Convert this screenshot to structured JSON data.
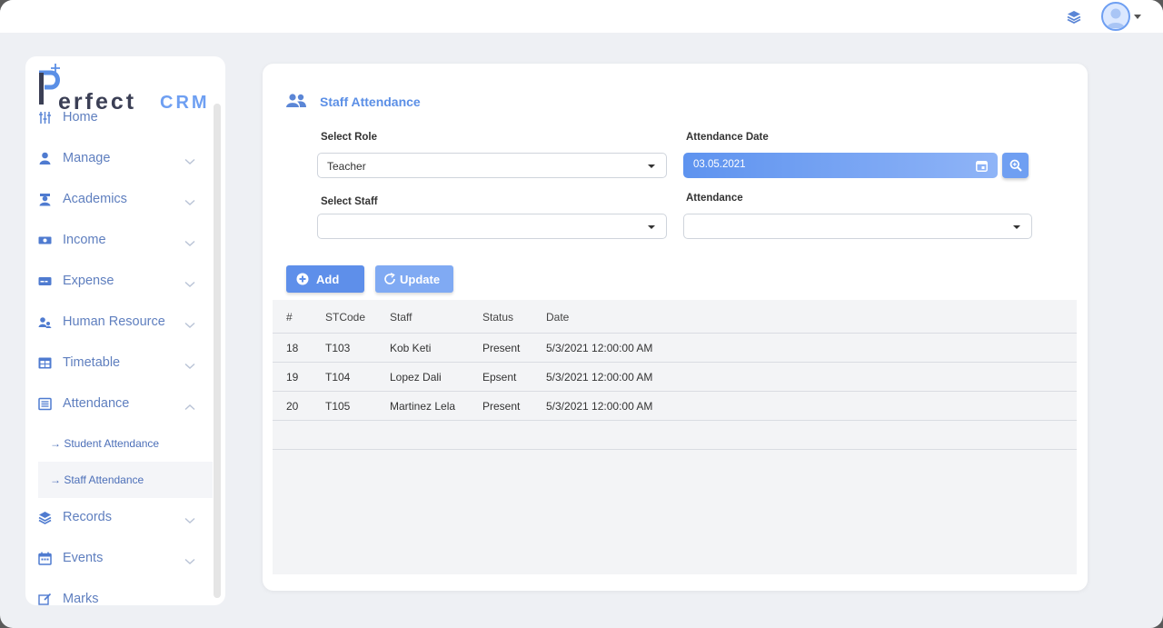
{
  "topbar": {
    "layers_icon": "layers-icon",
    "avatar_icon": "user-avatar-icon"
  },
  "sidebar": {
    "logo_main": "erfect",
    "logo_suffix": "CRM",
    "items": [
      {
        "label": "Home",
        "icon": "sliders-icon"
      },
      {
        "label": "Manage",
        "icon": "user-icon"
      },
      {
        "label": "Academics",
        "icon": "graduate-icon"
      },
      {
        "label": "Income",
        "icon": "cash-icon"
      },
      {
        "label": "Expense",
        "icon": "card-icon"
      },
      {
        "label": "Human Resource",
        "icon": "users-icon"
      },
      {
        "label": "Timetable",
        "icon": "table-icon"
      },
      {
        "label": "Attendance",
        "icon": "list-icon"
      },
      {
        "label": "Records",
        "icon": "layers-icon"
      },
      {
        "label": "Events",
        "icon": "calendar-icon"
      },
      {
        "label": "Marks",
        "icon": "edit-icon"
      }
    ],
    "attendance_sub": [
      {
        "label": "→ Student Attendance"
      },
      {
        "label": "→ Staff Attendance"
      }
    ]
  },
  "main": {
    "title": "Staff Attendance",
    "select_role_label": "Select Role",
    "select_role_value": "Teacher",
    "attendance_date_label": "Attendance Date",
    "attendance_date_value": "03.05.2021",
    "select_staff_label": "Select Staff",
    "select_staff_value": "",
    "attendance_label": "Attendance",
    "attendance_value": "",
    "add_label": "Add",
    "update_label": "Update"
  },
  "table": {
    "headers": [
      "#",
      "STCode",
      "Staff",
      "Status",
      "Date"
    ],
    "rows": [
      [
        "18",
        "T103",
        "Kob Keti",
        "Present",
        "5/3/2021 12:00:00 AM"
      ],
      [
        "19",
        "T104",
        "Lopez Dali",
        "Epsent",
        "5/3/2021 12:00:00 AM"
      ],
      [
        "20",
        "T105",
        "Martinez Lela",
        "Present",
        "5/3/2021 12:00:00 AM"
      ]
    ]
  },
  "colors": {
    "accent": "#5e8fea",
    "nav_text": "#5f7fbf",
    "background": "#eef0f4"
  }
}
